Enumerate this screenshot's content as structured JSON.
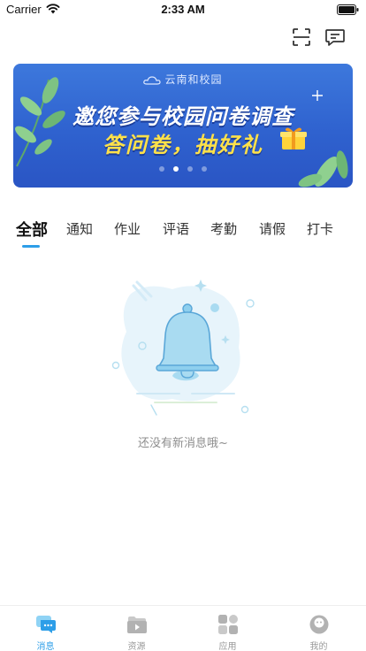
{
  "status_bar": {
    "carrier": "Carrier",
    "time": "2:33 AM"
  },
  "header": {
    "scan_icon": "scan-icon",
    "message_icon": "chat-bubble-icon"
  },
  "banner": {
    "logo_text": "云南和校园",
    "line1": "邀您参与校园问卷调查",
    "line2": "答问卷，抽好礼",
    "slide_count": 4,
    "active_slide": 2,
    "colors": {
      "background": "#3068d4",
      "title": "#ffffff",
      "highlight": "#ffe14a"
    }
  },
  "tabs": [
    {
      "label": "全部",
      "active": true
    },
    {
      "label": "通知",
      "active": false
    },
    {
      "label": "作业",
      "active": false
    },
    {
      "label": "评语",
      "active": false
    },
    {
      "label": "考勤",
      "active": false
    },
    {
      "label": "请假",
      "active": false
    },
    {
      "label": "打卡",
      "active": false
    }
  ],
  "empty_state": {
    "icon": "bell-icon",
    "text": "还没有新消息哦~"
  },
  "bottom_nav": [
    {
      "label": "消息",
      "icon": "message-icon",
      "active": true
    },
    {
      "label": "资源",
      "icon": "video-folder-icon",
      "active": false
    },
    {
      "label": "应用",
      "icon": "apps-grid-icon",
      "active": false
    },
    {
      "label": "我的",
      "icon": "profile-icon",
      "active": false
    }
  ],
  "accent_color": "#2d9ee8"
}
